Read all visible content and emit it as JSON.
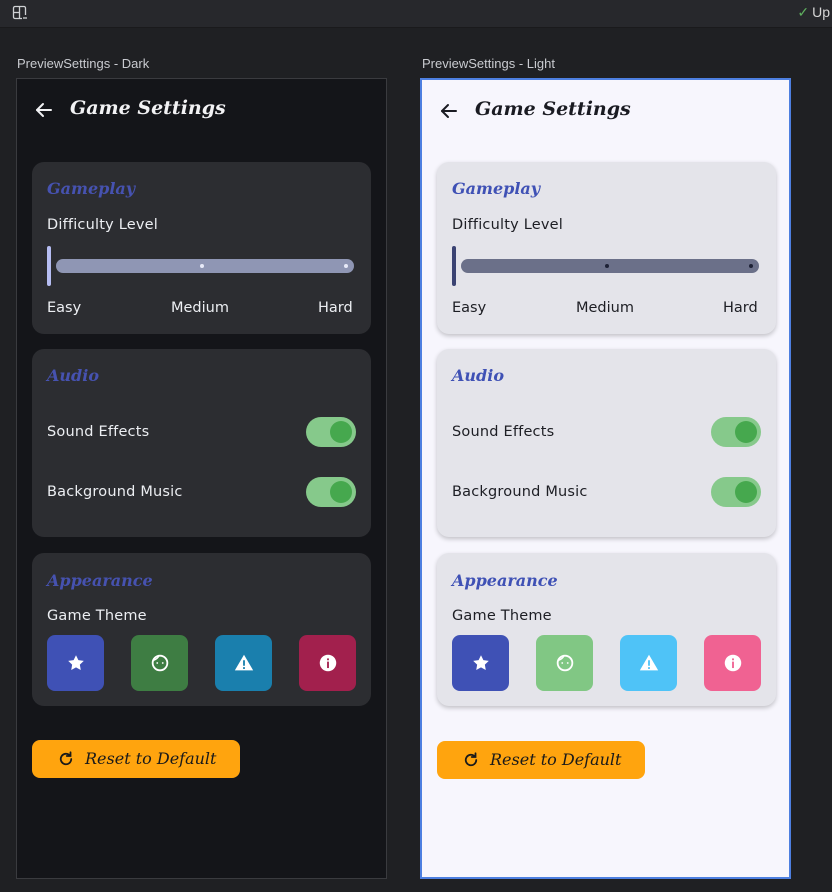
{
  "topbar": {
    "layout_icon": "split-layout-icon",
    "status_check_icon": "check-icon",
    "status_text": "Up"
  },
  "previews": [
    {
      "label": "PreviewSettings - Dark",
      "theme": "dark",
      "app_title": "Game Settings",
      "back_icon": "arrow-left-icon",
      "gameplay": {
        "title": "Gameplay",
        "difficulty_label": "Difficulty Level",
        "slider_value_fraction": 0.0,
        "stops": [
          "Easy",
          "Medium",
          "Hard"
        ]
      },
      "audio": {
        "title": "Audio",
        "sound_effects_label": "Sound Effects",
        "sound_effects_on": true,
        "music_label": "Background Music",
        "music_on": true
      },
      "appearance": {
        "title": "Appearance",
        "theme_label": "Game Theme",
        "themes": [
          {
            "icon": "star-icon",
            "color": "#3f51b5"
          },
          {
            "icon": "face-icon",
            "color": "#3e7d43"
          },
          {
            "icon": "warning-icon",
            "color": "#1a7fad"
          },
          {
            "icon": "info-icon",
            "color": "#a2204d"
          }
        ]
      },
      "reset_label": "Reset to Default",
      "reset_icon": "refresh-icon"
    },
    {
      "label": "PreviewSettings - Light",
      "theme": "light",
      "app_title": "Game Settings",
      "back_icon": "arrow-left-icon",
      "gameplay": {
        "title": "Gameplay",
        "difficulty_label": "Difficulty Level",
        "slider_value_fraction": 0.0,
        "stops": [
          "Easy",
          "Medium",
          "Hard"
        ]
      },
      "audio": {
        "title": "Audio",
        "sound_effects_label": "Sound Effects",
        "sound_effects_on": true,
        "music_label": "Background Music",
        "music_on": true
      },
      "appearance": {
        "title": "Appearance",
        "theme_label": "Game Theme",
        "themes": [
          {
            "icon": "star-icon",
            "color": "#3f51b5"
          },
          {
            "icon": "face-icon",
            "color": "#81c784"
          },
          {
            "icon": "warning-icon",
            "color": "#4fc3f7"
          },
          {
            "icon": "info-icon",
            "color": "#f06292"
          }
        ]
      },
      "reset_label": "Reset to Default",
      "reset_icon": "refresh-icon"
    }
  ]
}
